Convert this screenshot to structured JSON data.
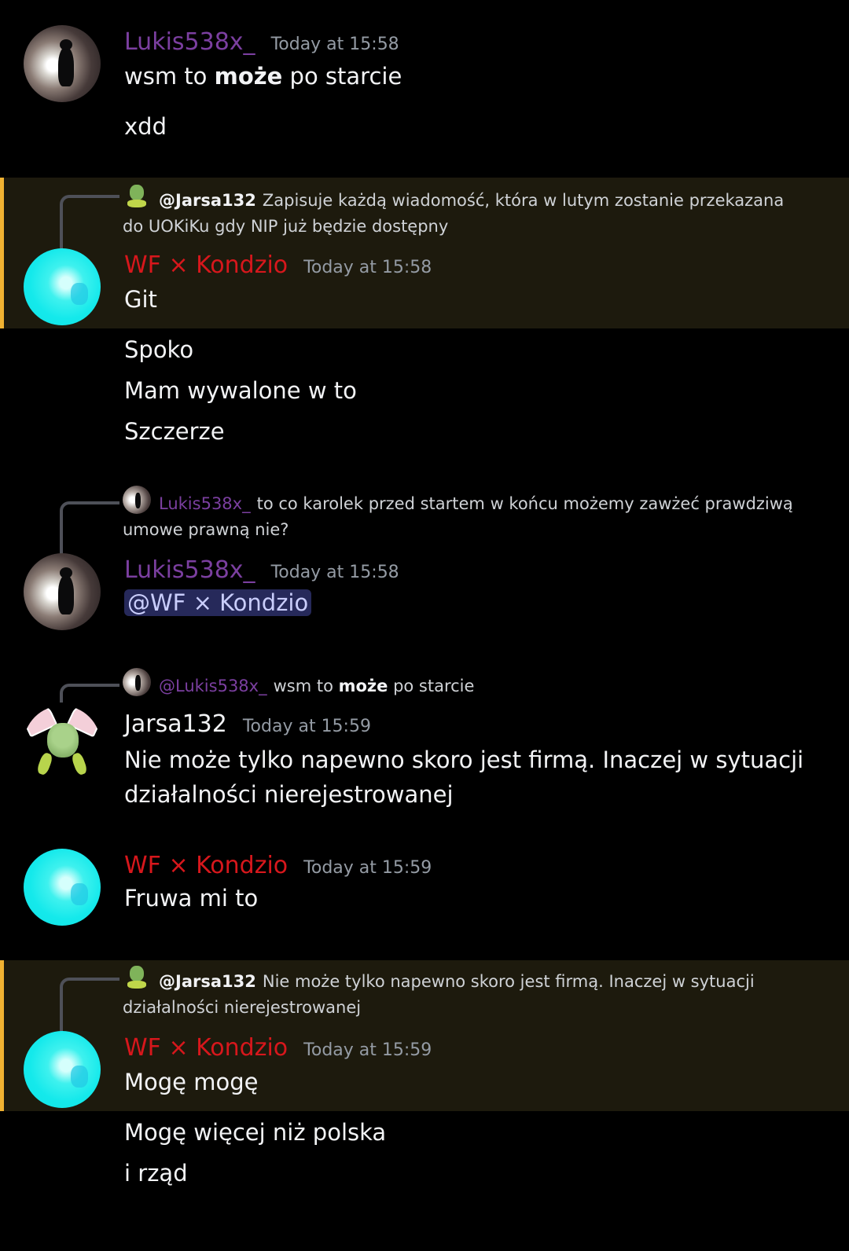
{
  "messages": [
    {
      "author": "Lukis538x_",
      "timestamp": "Today at 15:58",
      "line1_a": "wsm to ",
      "line1_bold": "może",
      "line1_b": " po starcie",
      "line2": "xdd"
    },
    {
      "reply_author": "@Jarsa132",
      "reply_text": "Zapisuje każdą wiadomość, która w lutym zostanie przekazana do UOKiKu gdy NIP już będzie dostępny",
      "author": "WF × Kondzio",
      "timestamp": "Today at 15:58",
      "lines": [
        "Git",
        "Spoko",
        "Mam wywalone w to",
        "Szczerze"
      ]
    },
    {
      "reply_author": "Lukis538x_",
      "reply_text": "to co karolek przed startem w końcu możemy zawżeć prawdziwą umowe prawną nie?",
      "author": "Lukis538x_",
      "timestamp": "Today at 15:58",
      "mention": "@WF × Kondzio"
    },
    {
      "reply_author": "@Lukis538x_",
      "reply_a": "wsm to ",
      "reply_bold": "może",
      "reply_b": " po starcie",
      "author": "Jarsa132",
      "timestamp": "Today at 15:59",
      "line1": "Nie może tylko napewno skoro jest firmą. Inaczej w sytuacji",
      "line2": "działalności nierejestrowanej"
    },
    {
      "author": "WF × Kondzio",
      "timestamp": "Today at 15:59",
      "line1": "Fruwa mi to"
    },
    {
      "reply_author": "@Jarsa132",
      "reply_text": "Nie może tylko napewno skoro jest firmą. Inaczej w sytuacji działalności nierejestrowanej",
      "author": "WF × Kondzio",
      "timestamp": "Today at 15:59",
      "lines": [
        "Mogę mogę",
        "Mogę więcej niż polska",
        "i rząd"
      ]
    }
  ],
  "colors": {
    "background": "#000000",
    "highlight_bg": "#1d1a0d",
    "highlight_bar": "#f0b232",
    "lukis_name": "#7b3fa0",
    "kondzio_name": "#d7171c",
    "mention_bg": "#26295a"
  }
}
